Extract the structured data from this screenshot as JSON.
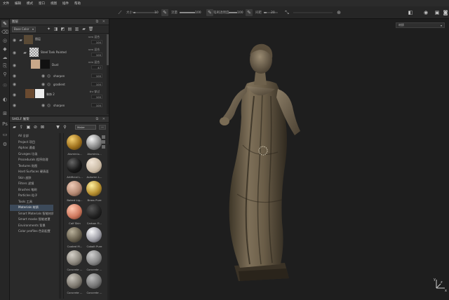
{
  "menu": [
    "文件",
    "编辑",
    "模式",
    "窗口",
    "视图",
    "插件",
    "帮助"
  ],
  "toolbar": {
    "size_label": "大小",
    "size_value": "10",
    "flow_label": "流量",
    "flow_value": "100",
    "opacity_label": "笔刷透明度",
    "opacity_value": "100",
    "spacing_label": "间距",
    "spacing_value": "20",
    "size_level": 0.1,
    "flow_level": 1.0,
    "opacity_level": 1.0,
    "spacing_level": 0.2
  },
  "layers": {
    "title": "图层",
    "channel": "Base Color",
    "rows": [
      {
        "name": "图层",
        "blend": "nrm 混合",
        "opacity": "100",
        "kind": "group"
      },
      {
        "name": "Steel Tank Painted",
        "blend": "nrm 混合",
        "opacity": "100",
        "kind": "fill"
      },
      {
        "name": "Dust",
        "blend": "nrm 混合",
        "opacity": "47",
        "kind": "mask"
      },
      {
        "name": "sharpen",
        "blend": "",
        "opacity": "100",
        "kind": "effect"
      },
      {
        "name": "gradient",
        "blend": "",
        "opacity": "100",
        "kind": "effect"
      },
      {
        "name": "装饰 2",
        "blend": "thr 穿过",
        "opacity": "100",
        "kind": "mask2"
      },
      {
        "name": "sharpen",
        "blend": "",
        "opacity": "100",
        "kind": "effect"
      }
    ]
  },
  "shelf": {
    "title": "SHELF 展架",
    "search_value": "Mater",
    "categories": [
      "All 全部",
      "Project 项目",
      "Alphas 通道",
      "Grunges 垃圾",
      "Procedurals 程序纹理",
      "Textures 贴图",
      "Hard Surfaces 硬表面",
      "Skin 皮肤",
      "Filters 滤镜",
      "Brushes 笔刷",
      "Particles 粒子",
      "Tools 工具",
      "Materials 材质",
      "Smart Materials 智能材质",
      "Smart masks 智能遮罩",
      "Environments 背景",
      "Color profiles 色彩配置"
    ],
    "selected_category": "Materials 材质",
    "materials": [
      {
        "label": "Aluminiu...",
        "color": "gold"
      },
      {
        "label": "Aluminiu...",
        "color": "silver"
      },
      {
        "label": "Artificial L...",
        "color": "black"
      },
      {
        "label": "Autumn L...",
        "color": "leaf"
      },
      {
        "label": "Baked Lig...",
        "color": "skin"
      },
      {
        "label": "Brass Pure",
        "color": "brass"
      },
      {
        "label": "Calf Skin",
        "color": "calf"
      },
      {
        "label": "Carbon Fi...",
        "color": "carbon"
      },
      {
        "label": "Coated M...",
        "color": "coated"
      },
      {
        "label": "Cobalt Pure",
        "color": "cobalt"
      },
      {
        "label": "Concrete ...",
        "color": "concrete1"
      },
      {
        "label": "Concrete ...",
        "color": "concrete2"
      },
      {
        "label": "Concrete ...",
        "color": "concrete3"
      },
      {
        "label": "Concrete ...",
        "color": "concrete4"
      }
    ]
  },
  "viewport": {
    "display_select": "材质",
    "axis_labels": {
      "x": "x",
      "y": "y",
      "z": "z"
    }
  }
}
